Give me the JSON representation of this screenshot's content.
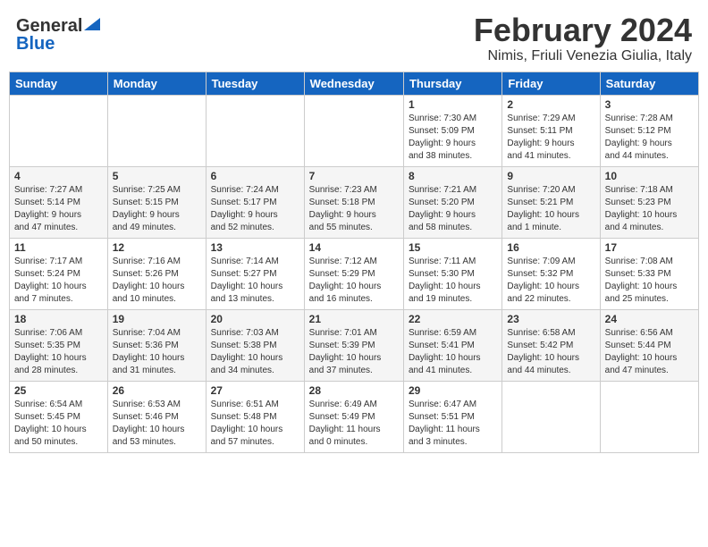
{
  "header": {
    "logo_general": "General",
    "logo_blue": "Blue",
    "month_title": "February 2024",
    "location": "Nimis, Friuli Venezia Giulia, Italy"
  },
  "days_of_week": [
    "Sunday",
    "Monday",
    "Tuesday",
    "Wednesday",
    "Thursday",
    "Friday",
    "Saturday"
  ],
  "weeks": [
    [
      {
        "day": "",
        "info": ""
      },
      {
        "day": "",
        "info": ""
      },
      {
        "day": "",
        "info": ""
      },
      {
        "day": "",
        "info": ""
      },
      {
        "day": "1",
        "info": "Sunrise: 7:30 AM\nSunset: 5:09 PM\nDaylight: 9 hours\nand 38 minutes."
      },
      {
        "day": "2",
        "info": "Sunrise: 7:29 AM\nSunset: 5:11 PM\nDaylight: 9 hours\nand 41 minutes."
      },
      {
        "day": "3",
        "info": "Sunrise: 7:28 AM\nSunset: 5:12 PM\nDaylight: 9 hours\nand 44 minutes."
      }
    ],
    [
      {
        "day": "4",
        "info": "Sunrise: 7:27 AM\nSunset: 5:14 PM\nDaylight: 9 hours\nand 47 minutes."
      },
      {
        "day": "5",
        "info": "Sunrise: 7:25 AM\nSunset: 5:15 PM\nDaylight: 9 hours\nand 49 minutes."
      },
      {
        "day": "6",
        "info": "Sunrise: 7:24 AM\nSunset: 5:17 PM\nDaylight: 9 hours\nand 52 minutes."
      },
      {
        "day": "7",
        "info": "Sunrise: 7:23 AM\nSunset: 5:18 PM\nDaylight: 9 hours\nand 55 minutes."
      },
      {
        "day": "8",
        "info": "Sunrise: 7:21 AM\nSunset: 5:20 PM\nDaylight: 9 hours\nand 58 minutes."
      },
      {
        "day": "9",
        "info": "Sunrise: 7:20 AM\nSunset: 5:21 PM\nDaylight: 10 hours\nand 1 minute."
      },
      {
        "day": "10",
        "info": "Sunrise: 7:18 AM\nSunset: 5:23 PM\nDaylight: 10 hours\nand 4 minutes."
      }
    ],
    [
      {
        "day": "11",
        "info": "Sunrise: 7:17 AM\nSunset: 5:24 PM\nDaylight: 10 hours\nand 7 minutes."
      },
      {
        "day": "12",
        "info": "Sunrise: 7:16 AM\nSunset: 5:26 PM\nDaylight: 10 hours\nand 10 minutes."
      },
      {
        "day": "13",
        "info": "Sunrise: 7:14 AM\nSunset: 5:27 PM\nDaylight: 10 hours\nand 13 minutes."
      },
      {
        "day": "14",
        "info": "Sunrise: 7:12 AM\nSunset: 5:29 PM\nDaylight: 10 hours\nand 16 minutes."
      },
      {
        "day": "15",
        "info": "Sunrise: 7:11 AM\nSunset: 5:30 PM\nDaylight: 10 hours\nand 19 minutes."
      },
      {
        "day": "16",
        "info": "Sunrise: 7:09 AM\nSunset: 5:32 PM\nDaylight: 10 hours\nand 22 minutes."
      },
      {
        "day": "17",
        "info": "Sunrise: 7:08 AM\nSunset: 5:33 PM\nDaylight: 10 hours\nand 25 minutes."
      }
    ],
    [
      {
        "day": "18",
        "info": "Sunrise: 7:06 AM\nSunset: 5:35 PM\nDaylight: 10 hours\nand 28 minutes."
      },
      {
        "day": "19",
        "info": "Sunrise: 7:04 AM\nSunset: 5:36 PM\nDaylight: 10 hours\nand 31 minutes."
      },
      {
        "day": "20",
        "info": "Sunrise: 7:03 AM\nSunset: 5:38 PM\nDaylight: 10 hours\nand 34 minutes."
      },
      {
        "day": "21",
        "info": "Sunrise: 7:01 AM\nSunset: 5:39 PM\nDaylight: 10 hours\nand 37 minutes."
      },
      {
        "day": "22",
        "info": "Sunrise: 6:59 AM\nSunset: 5:41 PM\nDaylight: 10 hours\nand 41 minutes."
      },
      {
        "day": "23",
        "info": "Sunrise: 6:58 AM\nSunset: 5:42 PM\nDaylight: 10 hours\nand 44 minutes."
      },
      {
        "day": "24",
        "info": "Sunrise: 6:56 AM\nSunset: 5:44 PM\nDaylight: 10 hours\nand 47 minutes."
      }
    ],
    [
      {
        "day": "25",
        "info": "Sunrise: 6:54 AM\nSunset: 5:45 PM\nDaylight: 10 hours\nand 50 minutes."
      },
      {
        "day": "26",
        "info": "Sunrise: 6:53 AM\nSunset: 5:46 PM\nDaylight: 10 hours\nand 53 minutes."
      },
      {
        "day": "27",
        "info": "Sunrise: 6:51 AM\nSunset: 5:48 PM\nDaylight: 10 hours\nand 57 minutes."
      },
      {
        "day": "28",
        "info": "Sunrise: 6:49 AM\nSunset: 5:49 PM\nDaylight: 11 hours\nand 0 minutes."
      },
      {
        "day": "29",
        "info": "Sunrise: 6:47 AM\nSunset: 5:51 PM\nDaylight: 11 hours\nand 3 minutes."
      },
      {
        "day": "",
        "info": ""
      },
      {
        "day": "",
        "info": ""
      }
    ]
  ]
}
